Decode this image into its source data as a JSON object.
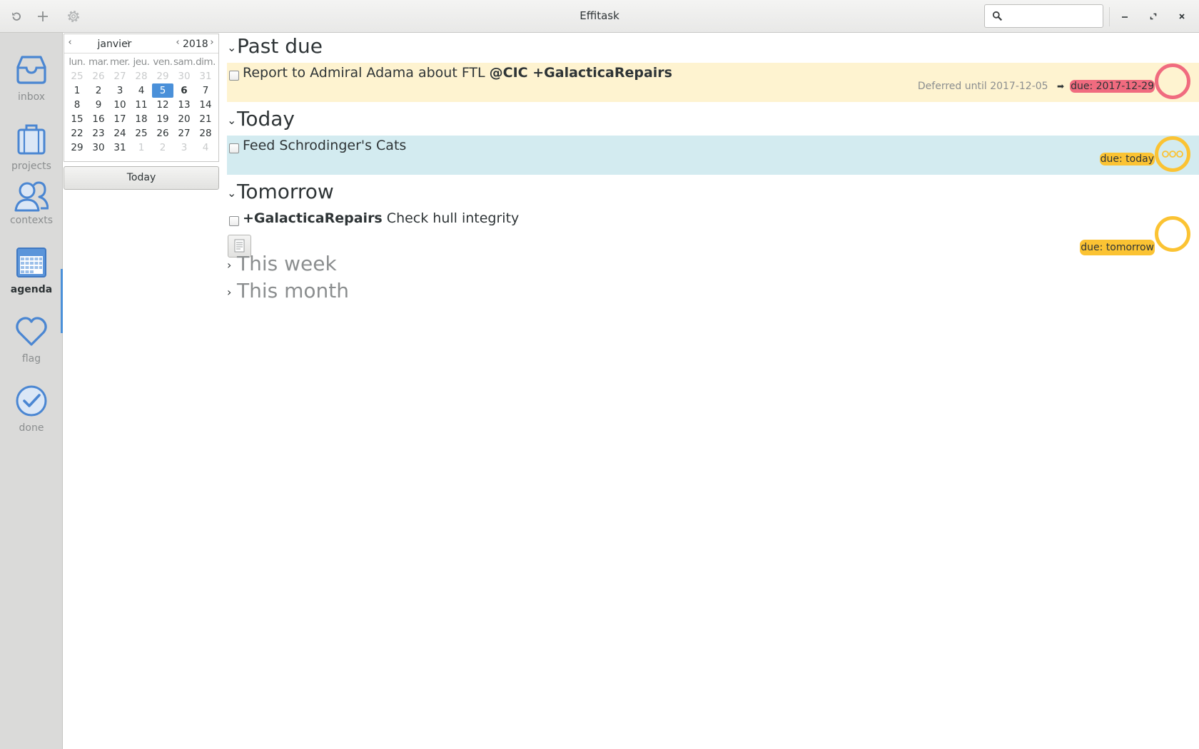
{
  "window": {
    "title": "Effitask",
    "search_placeholder": ""
  },
  "sidebar": {
    "items": [
      {
        "label": "inbox",
        "icon": "inbox-icon"
      },
      {
        "label": "projects",
        "icon": "briefcase-icon"
      },
      {
        "label": "contexts",
        "icon": "people-icon"
      },
      {
        "label": "agenda",
        "icon": "calendar-icon",
        "active": true
      },
      {
        "label": "flag",
        "icon": "heart-icon"
      },
      {
        "label": "done",
        "icon": "checkmark-icon"
      }
    ]
  },
  "calendar": {
    "month": "janvier",
    "year": "2018",
    "weekdays": [
      "lun.",
      "mar.",
      "mer.",
      "jeu.",
      "ven.",
      "sam.",
      "dim."
    ],
    "weeks": [
      [
        "25",
        "26",
        "27",
        "28",
        "29",
        "30",
        "31"
      ],
      [
        "1",
        "2",
        "3",
        "4",
        "5",
        "6",
        "7"
      ],
      [
        "8",
        "9",
        "10",
        "11",
        "12",
        "13",
        "14"
      ],
      [
        "15",
        "16",
        "17",
        "18",
        "19",
        "20",
        "21"
      ],
      [
        "22",
        "23",
        "24",
        "25",
        "26",
        "27",
        "28"
      ],
      [
        "29",
        "30",
        "31",
        "1",
        "2",
        "3",
        "4"
      ]
    ],
    "selected_day": "5",
    "bold_day": "6",
    "today_button": "Today"
  },
  "agenda": {
    "past_due": {
      "title": "Past due",
      "task": {
        "text": "Report to Admiral Adama about FTL",
        "tags": "@CIC +GalacticaRepairs",
        "deferred": "Deferred until 2017-12-05",
        "arrow": "➡",
        "due": "due: 2017-12-29"
      }
    },
    "today": {
      "title": "Today",
      "task": {
        "text": "Feed Schrodinger's Cats",
        "due": "due: today"
      }
    },
    "tomorrow": {
      "title": "Tomorrow",
      "task": {
        "project": "+GalacticaRepairs",
        "text": "Check hull integrity",
        "due": "due: tomorrow"
      }
    },
    "this_week": {
      "title": "This week"
    },
    "this_month": {
      "title": "This month"
    }
  },
  "colors": {
    "accent": "#4a90d9",
    "past_due_bg": "#fef3d0",
    "today_bg": "#d3ebf0",
    "overdue_pill": "#f06b7f",
    "due_pill": "#fbc333",
    "overdue_ring": "#f06b7f",
    "due_ring": "#fbc333"
  }
}
